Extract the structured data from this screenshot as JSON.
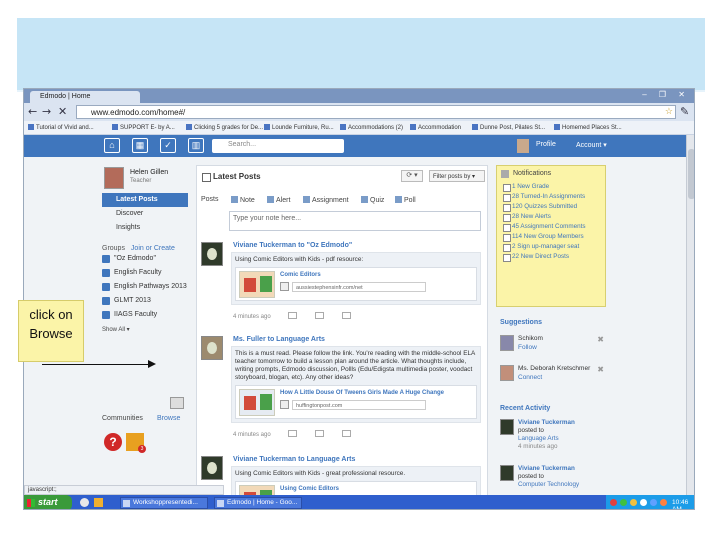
{
  "browser": {
    "tab_title": "Edmodo | Home",
    "url": "www.edmodo.com/home#/",
    "window_controls": "– ❐ ✕",
    "bookmarks": [
      "Tutorial of Vivid and...",
      "SUPPORT E- by A...",
      "Clicking 5 grades for De...",
      "Lounde Furniture, Ru...",
      "Accommodations (2)",
      "Accommodation",
      "Dunne Post, Pilates St...",
      "Homemed Places St..."
    ]
  },
  "edmodo": {
    "search_placeholder": "Search...",
    "profile_link": "Profile",
    "account_link": "Account ▾",
    "user": {
      "name": "Helen Gillen",
      "role": "Teacher"
    },
    "left_nav": [
      {
        "label": "Latest Posts",
        "active": true
      },
      {
        "label": "Discover",
        "active": false
      },
      {
        "label": "Insights",
        "active": false
      }
    ],
    "groups_label": "Groups",
    "join_create": "Join or Create",
    "groups": [
      "\"Oz Edmodo\"",
      "English Faculty",
      "English Pathways 2013",
      "GLMT 2013",
      "IIAGS Faculty"
    ],
    "show_all": "Show All ▾",
    "communities_label": "Communities",
    "browse_link": "Browse",
    "community_badge": "3",
    "latest_posts_title": "Latest Posts",
    "filter_label": "Filter posts by ▾",
    "refresh_label": "⟳ ▾",
    "post_label": "Posts",
    "post_types": [
      "Note",
      "Alert",
      "Assignment",
      "Quiz",
      "Poll"
    ],
    "note_placeholder": "Type your note here...",
    "posts": [
      {
        "header": "Viviane Tuckerman to \"Oz Edmodo\"",
        "body": "Using Comic Editors with Kids - pdf resource:",
        "link_title": "Comic Editors",
        "link_url": "aussiestephensinfr.com/net",
        "meta": "4 minutes ago"
      },
      {
        "header": "Ms. Fuller to Language Arts",
        "body": "This is a must read. Please follow the link. You're reading with the middle-school ELA teacher tomorrow to build a lesson plan around the article. What thoughts include, writing prompts, Edmodo discussion, Pollls (Edu/Edigsta multimedia poster, voodact storyboard, blogan, etc). Any other ideas?",
        "link_title": "How A Little Douse Of Tweens Girls Made A Huge Change",
        "link_url": "huffingtonpost.com",
        "meta": "4 minutes ago"
      },
      {
        "header": "Viviane Tuckerman to Language Arts",
        "body": "Using Comic Editors with Kids - great professional resource.",
        "link_title": "Using Comic Editors",
        "link_url": "",
        "meta": ""
      }
    ],
    "notifications_title": "Notifications",
    "notifications": [
      "1 New Grade",
      "28 Turned-In Assignments",
      "120 Quizzes Submitted",
      "28 New Alerts",
      "45 Assignment Comments",
      "114 New Group Members",
      "2 Sign up-manager seat",
      "22 New Direct Posts"
    ],
    "suggestions_title": "Suggestions",
    "suggestions": [
      {
        "name": "Schikom",
        "action": "Follow"
      },
      {
        "name": "Ms. Deborah Kretschmer",
        "action": "Connect"
      }
    ],
    "recent_activity_title": "Recent Activity",
    "recent_activity": [
      {
        "name": "Viviane Tuckerman",
        "action": "posted to",
        "target": "Language Arts",
        "time": "4 minutes ago"
      },
      {
        "name": "Viviane Tuckerman",
        "action": "posted to",
        "target": "Computer Technology",
        "time": ""
      }
    ],
    "status_bar": "javascript:;"
  },
  "taskbar": {
    "start": "start",
    "items": [
      "Workshoppresentedi...",
      "Edmodo | Home - Goo..."
    ],
    "clock": "10:46 AM"
  },
  "callout": {
    "line1": "click on",
    "line2": "Browse"
  },
  "colors": {
    "slide_accent": "#c6e5f6",
    "edmodo_blue": "#3f76bd",
    "notification_yellow": "#fbf4a8",
    "taskbar_blue": "#2f5fcd"
  }
}
